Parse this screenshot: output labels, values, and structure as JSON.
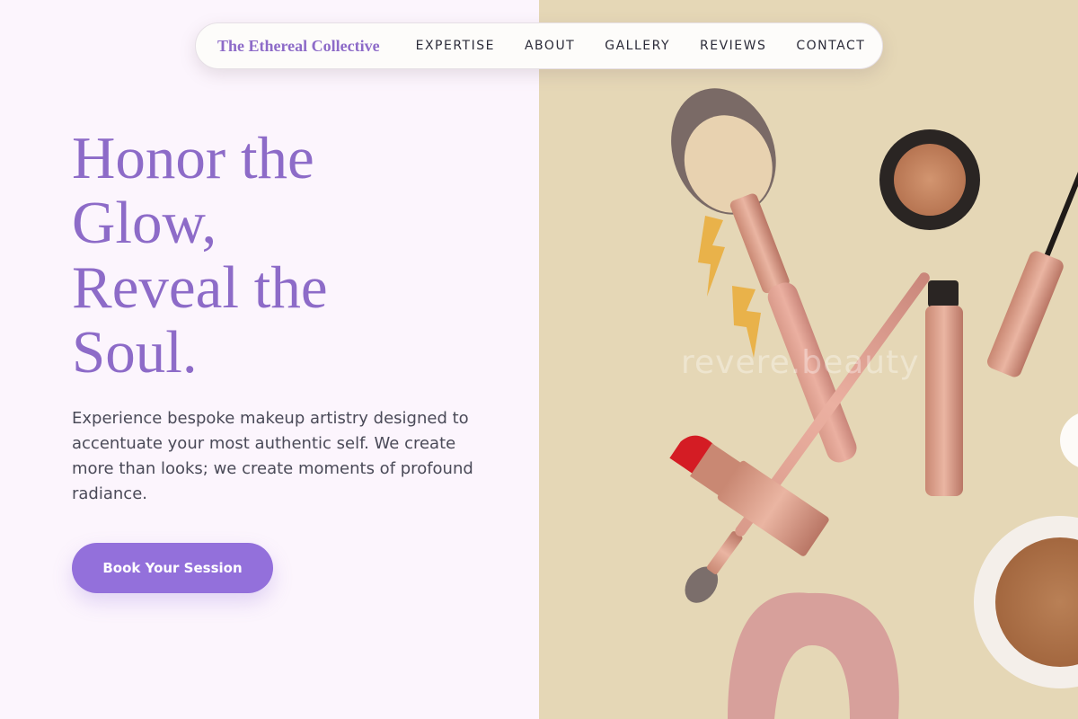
{
  "nav": {
    "brand": "The Ethereal Collective",
    "links": [
      "EXPERTISE",
      "ABOUT",
      "GALLERY",
      "REVIEWS",
      "CONTACT"
    ]
  },
  "hero": {
    "title_lines": [
      "Honor the",
      "Glow,",
      "Reveal the",
      "Soul."
    ],
    "description": "Experience bespoke makeup artistry designed to accentuate your most authentic self. We create more than looks; we create moments of profound radiance.",
    "cta_label": "Book Your Session"
  },
  "image": {
    "watermark": "revere.beauty",
    "subject": "makeup-flatlay-photo"
  },
  "colors": {
    "accent": "#9370db",
    "heading": "#8d6bc8",
    "left_background": "#fcf5fd",
    "right_background": "#e5d7b6"
  }
}
